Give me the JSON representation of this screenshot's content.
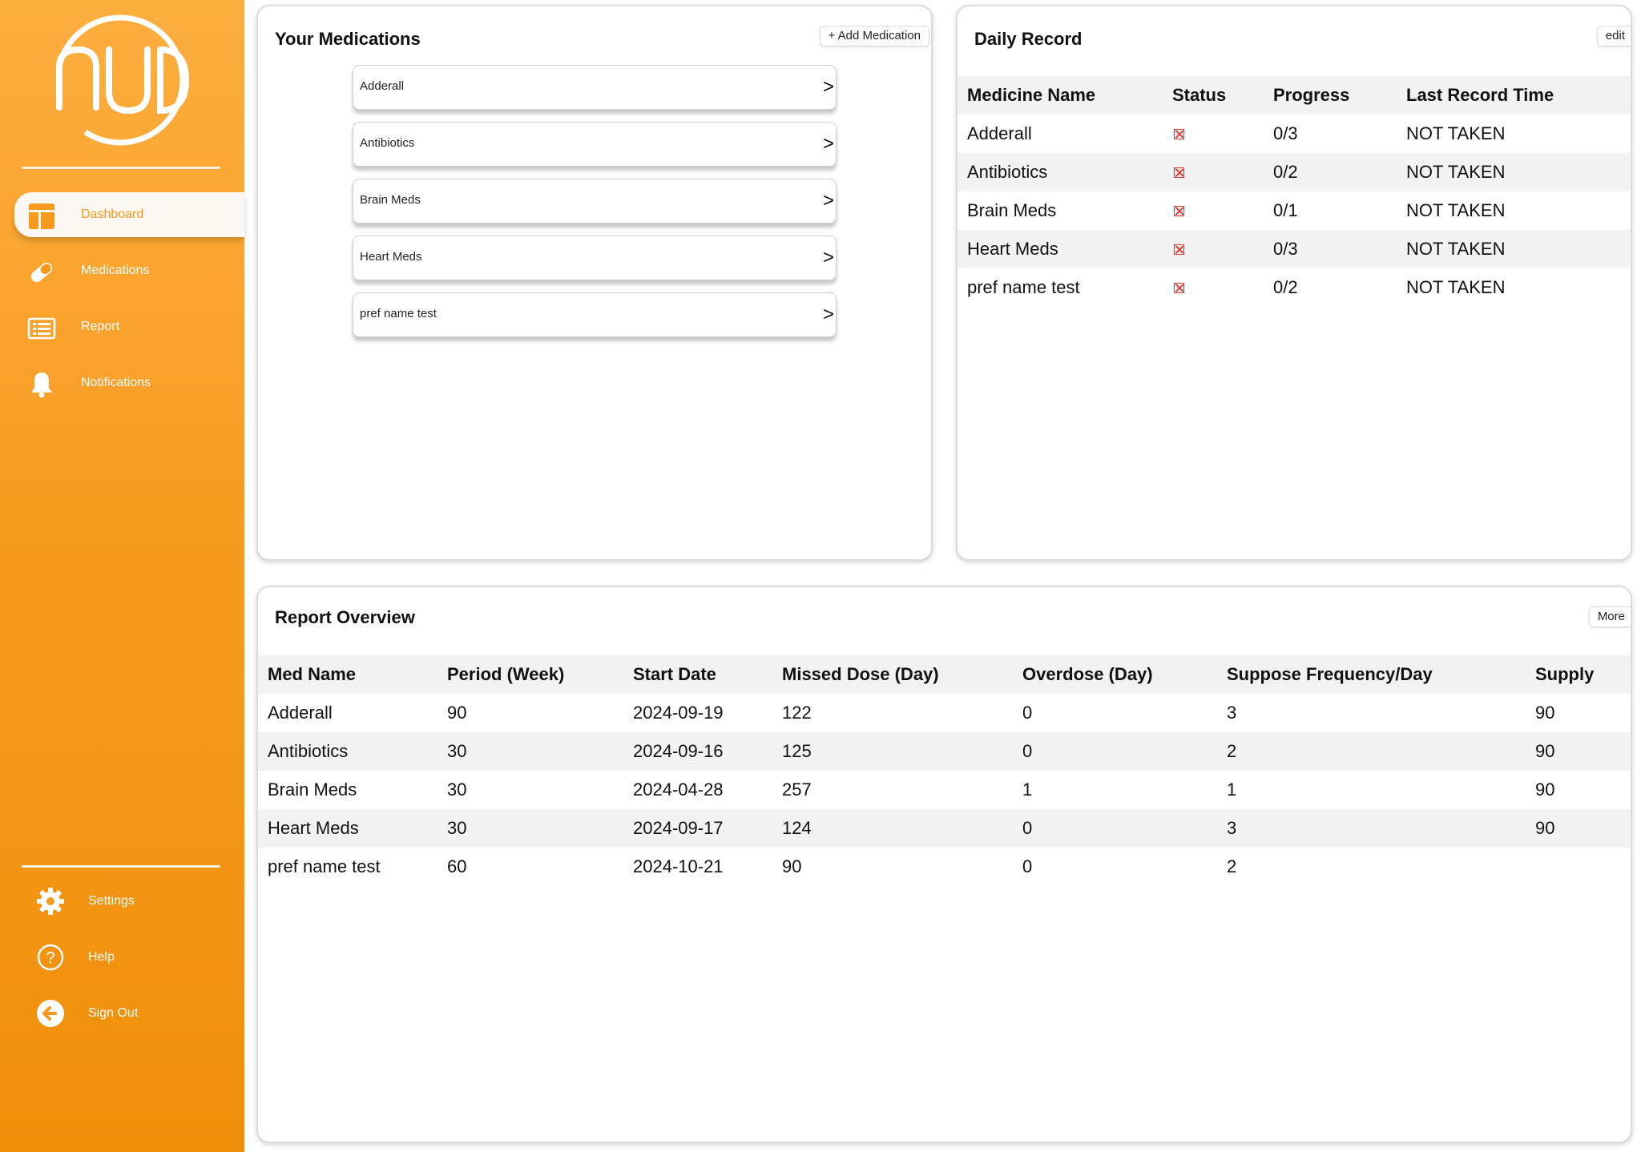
{
  "brand": {
    "logo_name": "hud-logo",
    "accent": "#f79a1e"
  },
  "sidebar": {
    "items": [
      {
        "label": "Dashboard",
        "icon": "dashboard-icon",
        "active": true
      },
      {
        "label": "Medications",
        "icon": "pill-icon"
      },
      {
        "label": "Report",
        "icon": "report-icon"
      },
      {
        "label": "Notifications",
        "icon": "bell-icon"
      }
    ],
    "bottom_items": [
      {
        "label": "Settings",
        "icon": "gear-icon"
      },
      {
        "label": "Help",
        "icon": "help-icon"
      },
      {
        "label": "Sign Out",
        "icon": "sign-out-icon"
      }
    ]
  },
  "medications": {
    "title": "Your Medications",
    "add_label": "+ Add Medication",
    "arrow": ">",
    "items": [
      "Adderall",
      "Antibiotics",
      "Brain Meds",
      "Heart Meds",
      "pref name test"
    ]
  },
  "daily_record": {
    "title": "Daily Record",
    "edit_label": "edit",
    "headers": [
      "Medicine Name",
      "Status",
      "Progress",
      "Last Record Time"
    ],
    "rows": [
      [
        "Adderall",
        "not-taken",
        "0/3",
        "NOT TAKEN"
      ],
      [
        "Antibiotics",
        "not-taken",
        "0/2",
        "NOT TAKEN"
      ],
      [
        "Brain Meds",
        "not-taken",
        "0/1",
        "NOT TAKEN"
      ],
      [
        "Heart Meds",
        "not-taken",
        "0/3",
        "NOT TAKEN"
      ],
      [
        "pref name test",
        "not-taken",
        "0/2",
        "NOT TAKEN"
      ]
    ]
  },
  "report": {
    "title": "Report Overview",
    "more_label": "More",
    "headers": [
      "Med Name",
      "Period (Week)",
      "Start Date",
      "Missed Dose (Day)",
      "Overdose (Day)",
      "Suppose Frequency/Day",
      "Supply"
    ],
    "rows": [
      [
        "Adderall",
        "90",
        "2024-09-19",
        "122",
        "0",
        "3",
        "90"
      ],
      [
        "Antibiotics",
        "30",
        "2024-09-16",
        "125",
        "0",
        "2",
        "90"
      ],
      [
        "Brain Meds",
        "30",
        "2024-04-28",
        "257",
        "1",
        "1",
        "90"
      ],
      [
        "Heart Meds",
        "30",
        "2024-09-17",
        "124",
        "0",
        "3",
        "90"
      ],
      [
        "pref name test",
        "60",
        "2024-10-21",
        "90",
        "0",
        "2",
        ""
      ]
    ]
  }
}
